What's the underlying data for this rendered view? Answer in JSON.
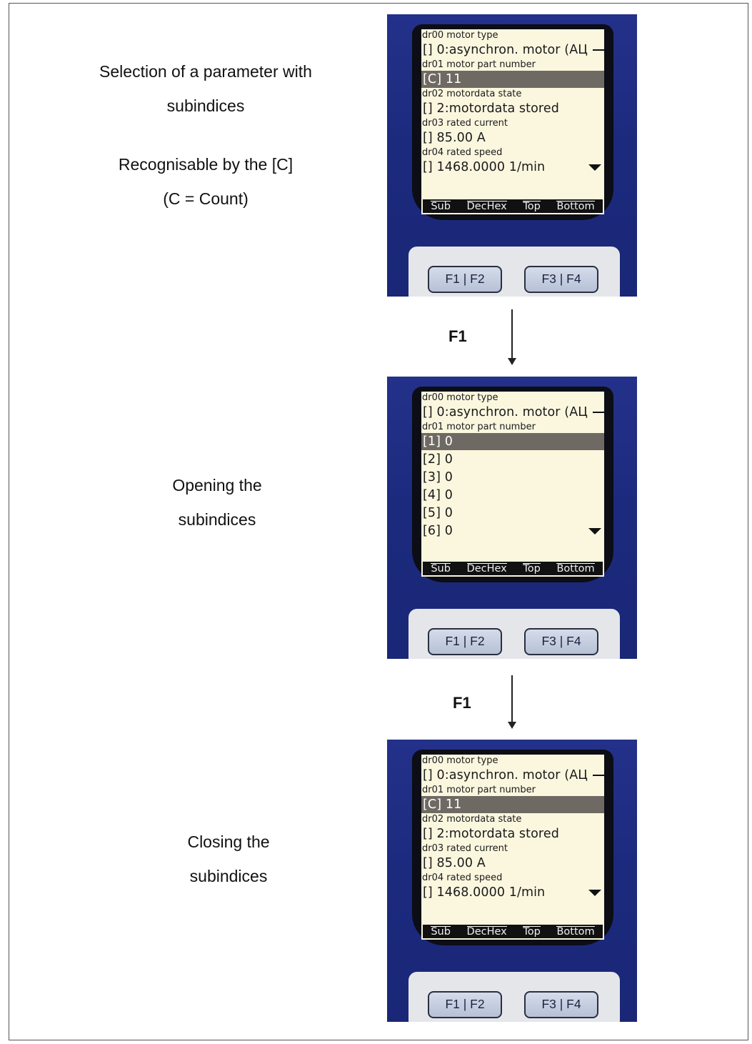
{
  "captions": {
    "step1": [
      "Selection of a parameter with",
      "subindices",
      "",
      "Recognisable by the [C]",
      "(C = Count)"
    ],
    "step2": [
      "Opening the",
      "subindices"
    ],
    "step3": [
      "Closing the",
      "subindices"
    ]
  },
  "transitions": {
    "t1": "F1",
    "t2": "F1"
  },
  "screens": {
    "s1": {
      "lines": [
        {
          "size": "small",
          "text": "dr00 motor type"
        },
        {
          "size": "big",
          "text": "[] 0:asynchron. motor (AЦ",
          "dash": true
        },
        {
          "size": "small",
          "text": "dr01 motor part number"
        },
        {
          "size": "big",
          "text": "[C] 11",
          "selected": true
        },
        {
          "size": "small",
          "text": "dr02 motordata state"
        },
        {
          "size": "big",
          "text": "[] 2:motordata stored"
        },
        {
          "size": "small",
          "text": "dr03 rated current"
        },
        {
          "size": "big",
          "text": "[] 85.00 A"
        },
        {
          "size": "small",
          "text": "dr04 rated speed"
        },
        {
          "size": "big",
          "text": "[] 1468.0000 1/min",
          "scroll": true
        }
      ]
    },
    "s2": {
      "lines": [
        {
          "size": "small",
          "text": "dr00 motor type"
        },
        {
          "size": "big",
          "text": "[] 0:asynchron. motor (AЦ",
          "dash": true
        },
        {
          "size": "small",
          "text": "dr01 motor part number"
        },
        {
          "size": "big",
          "text": "[1] 0",
          "selected": true
        },
        {
          "size": "big",
          "text": "[2] 0"
        },
        {
          "size": "big",
          "text": "[3] 0"
        },
        {
          "size": "big",
          "text": "[4] 0"
        },
        {
          "size": "big",
          "text": "[5] 0"
        },
        {
          "size": "big",
          "text": "[6] 0",
          "scroll": true
        }
      ]
    },
    "s3": {
      "lines": [
        {
          "size": "small",
          "text": "dr00 motor type"
        },
        {
          "size": "big",
          "text": "[] 0:asynchron. motor (AЦ",
          "dash": true
        },
        {
          "size": "small",
          "text": "dr01 motor part number"
        },
        {
          "size": "big",
          "text": "[C] 11",
          "selected": true
        },
        {
          "size": "small",
          "text": "dr02 motordata state"
        },
        {
          "size": "big",
          "text": "[] 2:motordata stored"
        },
        {
          "size": "small",
          "text": "dr03 rated current"
        },
        {
          "size": "big",
          "text": "[] 85.00 A"
        },
        {
          "size": "small",
          "text": "dr04 rated speed"
        },
        {
          "size": "big",
          "text": "[] 1468.0000 1/min",
          "scroll": true
        }
      ]
    }
  },
  "softkeys": [
    "Sub",
    "DecHex",
    "Top",
    "Bottom"
  ],
  "keys": {
    "left": "F1 | F2",
    "right": "F3 | F4"
  },
  "colors": {
    "device_blue": "#1f2d82",
    "screen_bg": "#fbf7df",
    "selected_row": "#6e6a63"
  }
}
